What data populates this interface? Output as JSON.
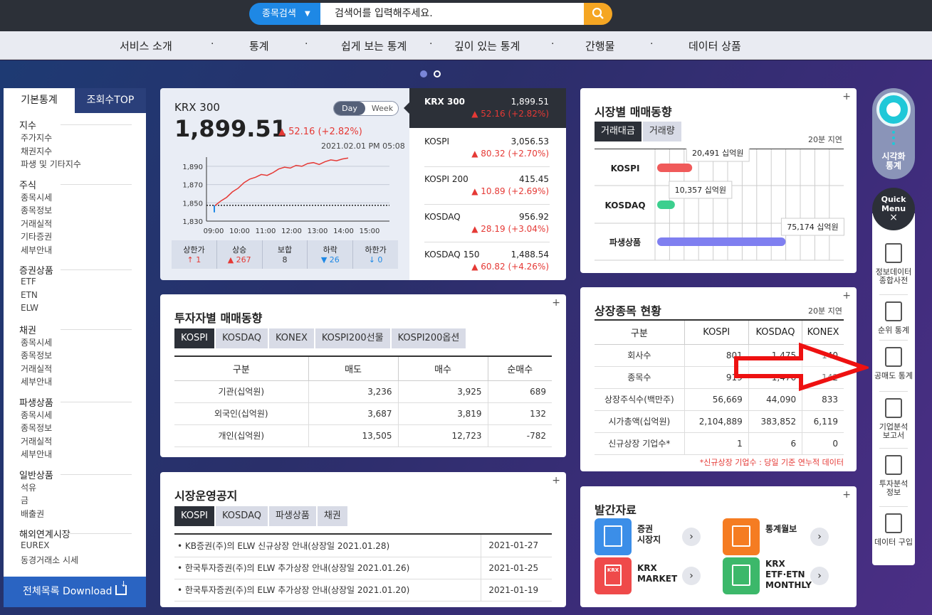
{
  "search": {
    "select_label": "종목검색",
    "placeholder": "검색어를 입력해주세요."
  },
  "nav": [
    "서비스 소개",
    "통계",
    "쉽게 보는 통계",
    "깊이 있는 통계",
    "간행물",
    "데이터 상품"
  ],
  "nav_sep": "·",
  "sidebar": {
    "tabs": [
      "기본통계",
      "조회수TOP"
    ],
    "groups": [
      {
        "label": "지수",
        "items": [
          "주가지수",
          "채권지수",
          "파생 및 기타지수"
        ]
      },
      {
        "label": "주식",
        "items": [
          "종목시세",
          "종목정보",
          "거래실적",
          "기타증권",
          "세부안내"
        ]
      },
      {
        "label": "증권상품",
        "items": [
          "ETF",
          "ETN",
          "ELW"
        ]
      },
      {
        "label": "채권",
        "items": [
          "종목시세",
          "종목정보",
          "거래실적",
          "세부안내"
        ]
      },
      {
        "label": "파생상품",
        "items": [
          "종목시세",
          "종목정보",
          "거래실적",
          "세부안내"
        ]
      },
      {
        "label": "일반상품",
        "items": [
          "석유",
          "금",
          "배출권"
        ]
      },
      {
        "label": "해외연계시장",
        "items": [
          "EUREX",
          "동경거래소 시세"
        ]
      }
    ],
    "download": "전체목록 Download"
  },
  "index_card": {
    "name": "KRX 300",
    "value": "1,899.51",
    "change": "▲ 52.16 (+2.82%)",
    "datetime": "2021.02.01 PM 05:08",
    "toggle": [
      "Day",
      "Week"
    ],
    "chart_data": {
      "type": "line",
      "x_ticks": [
        "09:00",
        "10:00",
        "11:00",
        "12:00",
        "13:00",
        "14:00",
        "15:00"
      ],
      "y_ticks": [
        "1,890",
        "1,870",
        "1,850",
        "1,830"
      ],
      "ylim": [
        1830,
        1900
      ],
      "baseline": 1847.35,
      "series": [
        {
          "values": [
            1847,
            1852,
            1856,
            1862,
            1866,
            1872,
            1876,
            1878,
            1881,
            1880,
            1883,
            1887,
            1889,
            1888,
            1891,
            1890,
            1893,
            1894,
            1892,
            1895,
            1897,
            1896,
            1898,
            1899
          ]
        }
      ]
    },
    "breadth": [
      {
        "label": "상한가",
        "value": "↑ 1",
        "color": "#e53935"
      },
      {
        "label": "상승",
        "value": "▲ 267",
        "color": "#e53935"
      },
      {
        "label": "보합",
        "value": "8",
        "color": "#333333"
      },
      {
        "label": "하락",
        "value": "▼ 26",
        "color": "#1e88e5"
      },
      {
        "label": "하한가",
        "value": "↓ 0",
        "color": "#1e88e5"
      }
    ],
    "list": [
      {
        "name": "KRX 300",
        "value": "1,899.51",
        "change": "▲ 52.16 (+2.82%)"
      },
      {
        "name": "KOSPI",
        "value": "3,056.53",
        "change": "▲ 80.32 (+2.70%)"
      },
      {
        "name": "KOSPI 200",
        "value": "415.45",
        "change": "▲ 10.89 (+2.69%)"
      },
      {
        "name": "KOSDAQ",
        "value": "956.92",
        "change": "▲ 28.19 (+3.04%)"
      },
      {
        "name": "KOSDAQ 150",
        "value": "1,488.54",
        "change": "▲ 60.82 (+4.26%)"
      }
    ]
  },
  "market_trade": {
    "title": "시장별 매매동향",
    "tabs": [
      "거래대금",
      "거래량"
    ],
    "delay": "20분 지연",
    "chart_data": {
      "type": "bar",
      "categories": [
        "KOSPI",
        "KOSDAQ",
        "파생상품"
      ],
      "values": [
        20491,
        10357,
        75174
      ],
      "labels": [
        "20,491 십억원",
        "10,357 십억원",
        "75,174 십억원"
      ],
      "colors": [
        "#f05a5a",
        "#3ccf8e",
        "#7f7ff0"
      ]
    }
  },
  "investor": {
    "title": "투자자별 매매동향",
    "tabs": [
      "KOSPI",
      "KOSDAQ",
      "KONEX",
      "KOSPI200선물",
      "KOSPI200옵션"
    ],
    "headers": [
      "구분",
      "매도",
      "매수",
      "순매수"
    ],
    "rows": [
      [
        "기관(십억원)",
        "3,236",
        "3,925",
        "689"
      ],
      [
        "외국인(십억원)",
        "3,687",
        "3,819",
        "132"
      ],
      [
        "개인(십억원)",
        "13,505",
        "12,723",
        "-782"
      ]
    ]
  },
  "listing": {
    "title": "상장종목 현황",
    "delay": "20분 지연",
    "headers": [
      "구분",
      "KOSPI",
      "KOSDAQ",
      "KONEX"
    ],
    "rows": [
      [
        "회사수",
        "801",
        "1,475",
        "140"
      ],
      [
        "종목수",
        "919",
        "1,476",
        "142"
      ],
      [
        "상장주식수(백만주)",
        "56,669",
        "44,090",
        "833"
      ],
      [
        "시가총액(십억원)",
        "2,104,889",
        "383,852",
        "6,119"
      ],
      [
        "신규상장 기업수*",
        "1",
        "6",
        "0"
      ]
    ],
    "note": "*신규상장 기업수 : 당일 기준 연누적 데이터"
  },
  "notice": {
    "title": "시장운영공지",
    "tabs": [
      "KOSPI",
      "KOSDAQ",
      "파생상품",
      "채권"
    ],
    "rows": [
      [
        "• KB증권(주)의 ELW 신규상장 안내(상장일 2021.01.28)",
        "2021-01-27"
      ],
      [
        "• 한국투자증권(주)의 ELW 추가상장 안내(상장일 2021.01.26)",
        "2021-01-25"
      ],
      [
        "• 한국투자증권(주)의 ELW 추가상장 안내(상장일 2021.01.20)",
        "2021-01-19"
      ]
    ]
  },
  "publications": {
    "title": "발간자료",
    "items": [
      {
        "label": "증권\n시장지",
        "color": "#3b8ee8"
      },
      {
        "label": "통계월보",
        "color": "#f57c22"
      },
      {
        "label": "KRX\nMARKET",
        "color": "#ef4a4a",
        "icon_text": "KRX"
      },
      {
        "label": "KRX\nETF·ETN\nMONTHLY",
        "color": "#3cb86a"
      }
    ]
  },
  "quick": {
    "visual": "시각화\n통계",
    "menu": "Quick\nMenu",
    "close": "×",
    "items": [
      "정보데이터\n종합사전",
      "순위 통계",
      "공매도 통계",
      "기업분석\n보고서",
      "투자분석\n정보",
      "데이터 구입"
    ]
  },
  "plus": "+"
}
